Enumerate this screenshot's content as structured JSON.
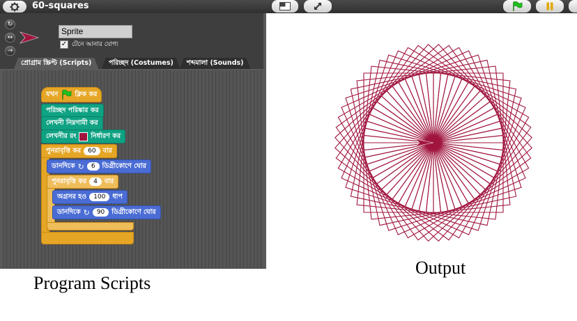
{
  "topbar": {
    "project_title": "60-squares",
    "icons": [
      "gear-icon",
      "stage-size-icon",
      "fullscreen-icon",
      "green-flag-icon",
      "pause-icon"
    ]
  },
  "sprite": {
    "name": "Sprite",
    "draggable_label": "টেনে আনার যোগ্য",
    "draggable_checked": true,
    "controls": [
      "rotate-icon",
      "left-right-icon",
      "no-rotate-icon"
    ]
  },
  "tabs": [
    {
      "label": "প্রোগ্রাম স্ক্রিপ্ট (Scripts)",
      "active": true
    },
    {
      "label": "পরিচ্ছদ (Costumes)",
      "active": false
    },
    {
      "label": "শব্দমালা (Sounds)",
      "active": false
    }
  ],
  "script": {
    "hat_prefix": "যখন",
    "hat_suffix": "ক্লিক কর",
    "clear": "পরিচ্ছদ পরিষ্কার কর",
    "pen_down": "লেখনী নিম্নগামী কর",
    "pen_color_prefix": "লেখনীর রং",
    "pen_color_suffix": "নির্ধারণ কর",
    "pen_color": "#a0153e",
    "repeat_outer_prefix": "পুনরাবৃত্তি কর",
    "repeat_outer_count": "60",
    "repeat_outer_suffix": "বার",
    "turn_right_prefix": "ডানদিকে",
    "turn_outer_degrees": "6",
    "turn_suffix": "ডিগ্রীকোণে ঘোর",
    "repeat_inner_prefix": "পুনরাবৃত্তি কর",
    "repeat_inner_count": "4",
    "repeat_inner_suffix": "বার",
    "move_prefix": "অগ্রসর হও",
    "move_steps": "100",
    "move_suffix": "ধাপ",
    "turn_inner_degrees": "90"
  },
  "output": {
    "squares": 60,
    "step_degrees": 6,
    "square_side": 100,
    "line_color": "#a0153e"
  },
  "captions": {
    "left": "Program Scripts",
    "right": "Output"
  }
}
